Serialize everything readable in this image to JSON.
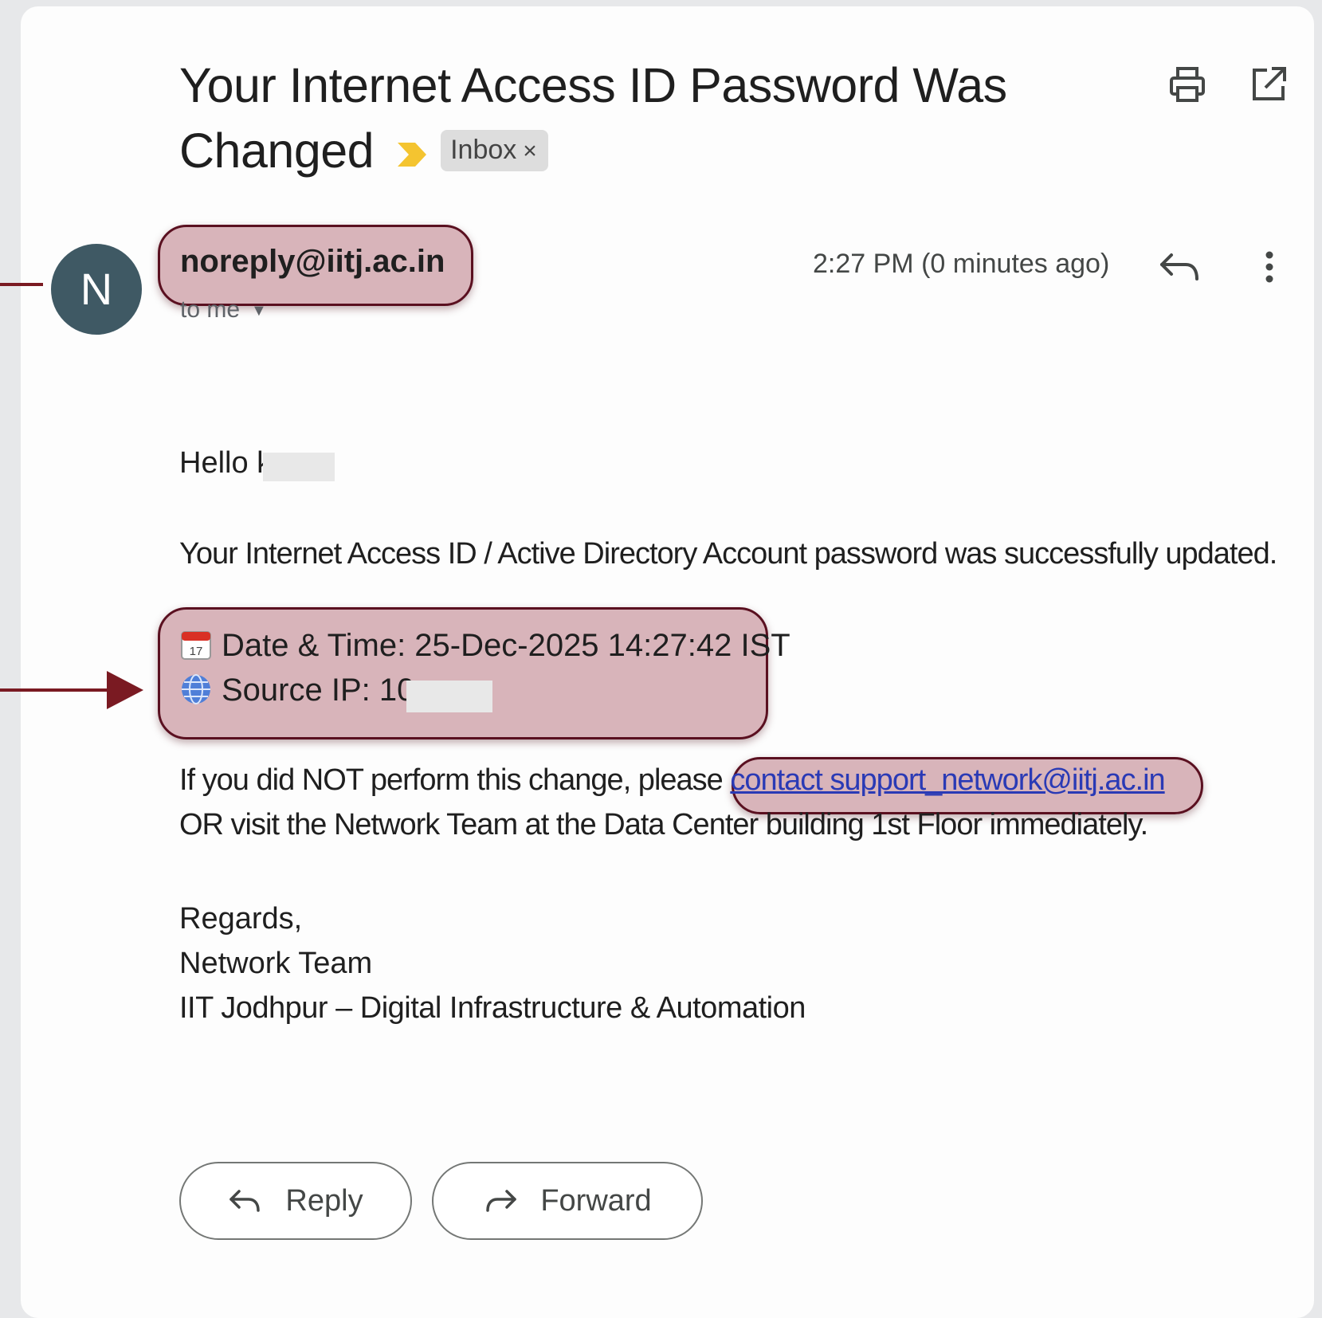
{
  "email": {
    "subject": "Your Internet Access ID Password Was Changed",
    "label_chip": "Inbox",
    "label_close": "×",
    "sender": {
      "avatar_letter": "N",
      "address": "noreply@iitj.ac.in",
      "recipient": "to me"
    },
    "timestamp": "2:27 PM (0 minutes ago)",
    "greeting": "Hello k",
    "line1": "Your Internet Access ID / Active Directory Account password was successfully updated.",
    "details": {
      "date_time": "Date & Time: 25-Dec-2025 14:27:42 IST",
      "source_ip": "Source IP: 10."
    },
    "instructions": {
      "prefix": "If you did NOT perform this change, please ",
      "link": "contact support_network@iitj.ac.in",
      "line2": "OR visit the Network Team at the Data Center building 1st Floor immediately."
    },
    "signature": {
      "regards": "Regards,",
      "team": "Network Team",
      "org": "IIT Jodhpur – Digital Infrastructure & Automation"
    }
  },
  "actions": {
    "reply_label": "Reply",
    "forward_label": "Forward"
  },
  "icons": {
    "importance": "importance-marker-icon",
    "print": "print-icon",
    "open_new_window": "open-in-new-window-icon",
    "reply": "reply-icon",
    "more": "more-vertical-icon",
    "calendar": "calendar-icon",
    "globe": "globe-icon",
    "forward": "forward-icon"
  },
  "colors": {
    "highlight_fill": "#c48a95",
    "highlight_border": "#5a1020",
    "pointer": "#7a1a22",
    "avatar": "#3f5964",
    "importance": "#f4c430",
    "link": "#2a3ab5"
  }
}
